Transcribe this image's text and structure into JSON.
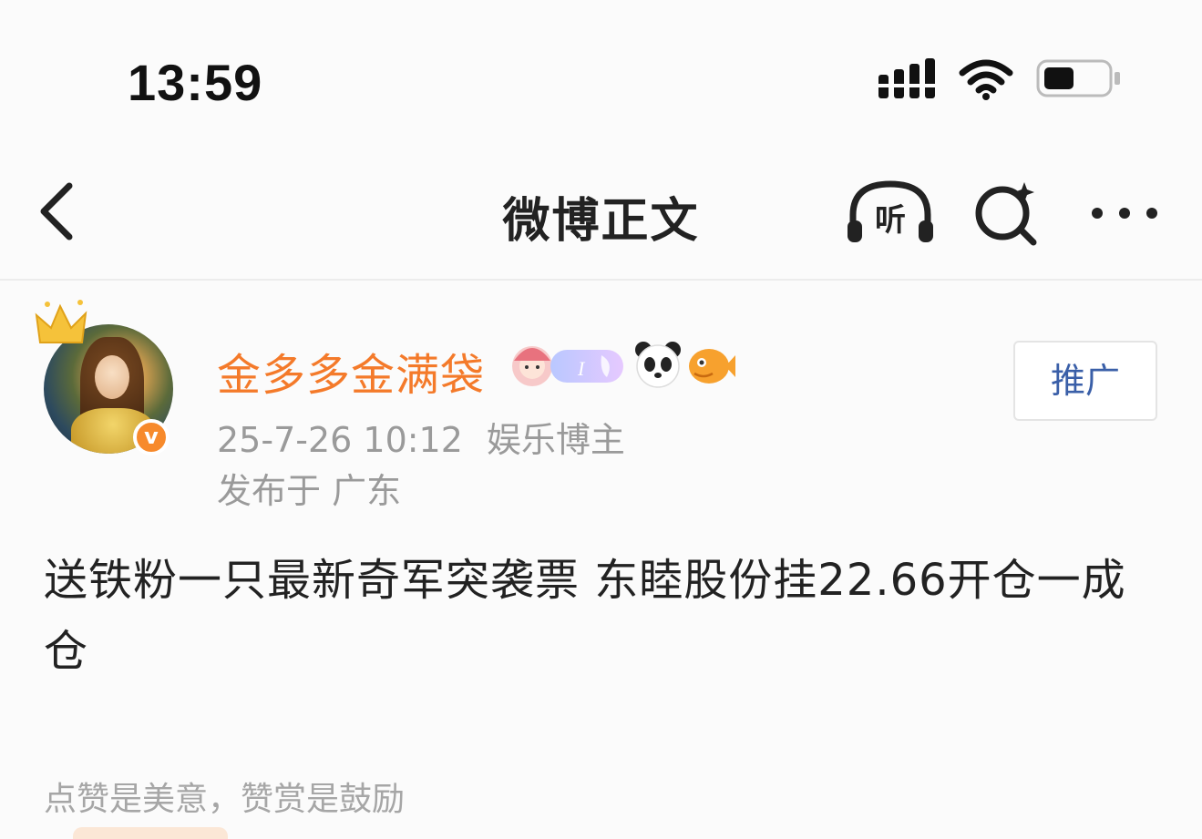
{
  "status_bar": {
    "time": "13:59",
    "icons": [
      "signal-icon",
      "wifi-icon",
      "battery-icon"
    ]
  },
  "nav": {
    "back_icon": "chevron-left-icon",
    "title": "微博正文",
    "listen_label": "听",
    "listen_icon": "headphones-icon",
    "search_icon": "search-sparkle-icon",
    "more_icon": "more-dots-icon"
  },
  "author": {
    "name": "金多多金满袋",
    "name_color": "#f47a2a",
    "verified_mark": "v",
    "badge_icons": [
      "avatar-badge-icon",
      "member-badge-icon",
      "panda-icon",
      "fish-icon"
    ],
    "date": "25-7-26 10:12",
    "role": "娱乐博主",
    "location": "发布于 广东",
    "promote_button": "推广"
  },
  "post": {
    "text": "送铁粉一只最新奇军突袭票 东睦股份挂22.66开仓一成仓"
  },
  "footer": {
    "encourage_text": "点赞是美意，赞赏是鼓励"
  },
  "colors": {
    "accent": "#f47a2a",
    "link": "#3a5fa8",
    "muted": "#9a9a9a"
  }
}
